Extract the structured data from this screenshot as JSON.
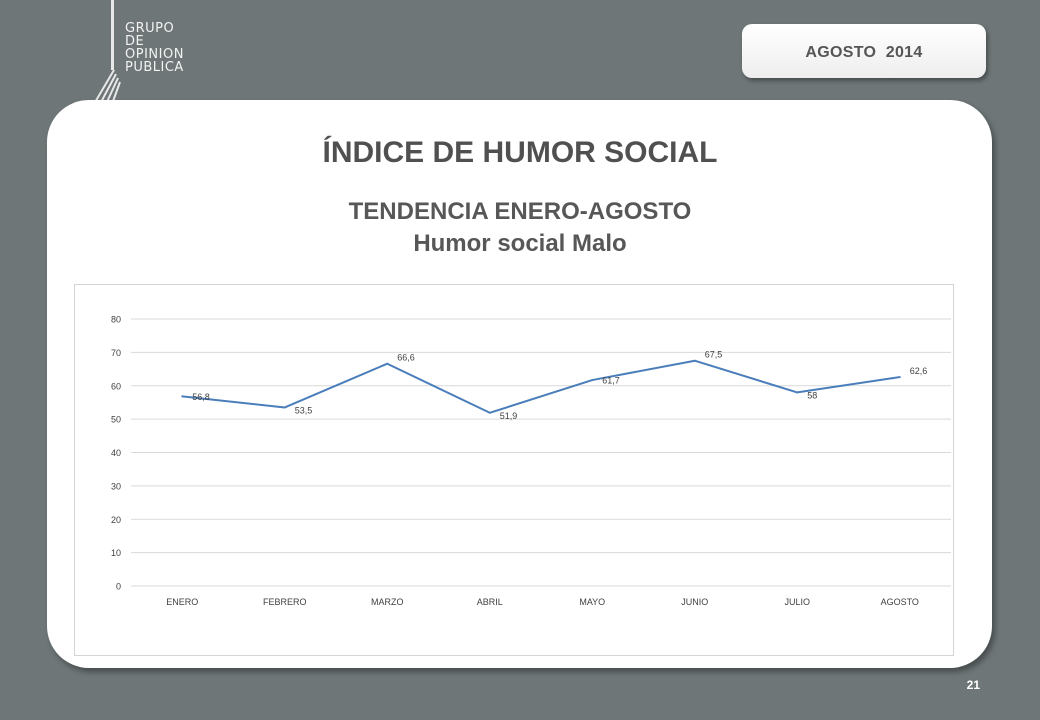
{
  "header": {
    "logo_lines": [
      "GRUPO",
      "DE",
      "OPINION",
      "PUBLICA"
    ],
    "date_label": "AGOSTO  2014"
  },
  "slide": {
    "title": "ÍNDICE DE HUMOR SOCIAL",
    "subtitle_line1": "TENDENCIA ENERO-AGOSTO",
    "subtitle_line2": "Humor social Malo",
    "page_number": "21"
  },
  "colors": {
    "background": "#6e7677",
    "line": "#4a7ebb",
    "text": "#505050"
  },
  "chart_data": {
    "type": "line",
    "categories": [
      "ENERO",
      "FEBRERO",
      "MARZO",
      "ABRIL",
      "MAYO",
      "JUNIO",
      "JULIO",
      "AGOSTO"
    ],
    "series": [
      {
        "values": [
          56.8,
          53.5,
          66.6,
          51.9,
          61.7,
          67.5,
          58,
          62.6
        ],
        "labels": [
          "56,8",
          "53,5",
          "66,6",
          "51,9",
          "61,7",
          "67,5",
          "58",
          "62,6"
        ]
      }
    ],
    "yticks": [
      "0",
      "10",
      "20",
      "30",
      "40",
      "50",
      "60",
      "70",
      "80"
    ],
    "ylim": [
      0,
      80
    ],
    "grid": true,
    "legend": "none"
  }
}
